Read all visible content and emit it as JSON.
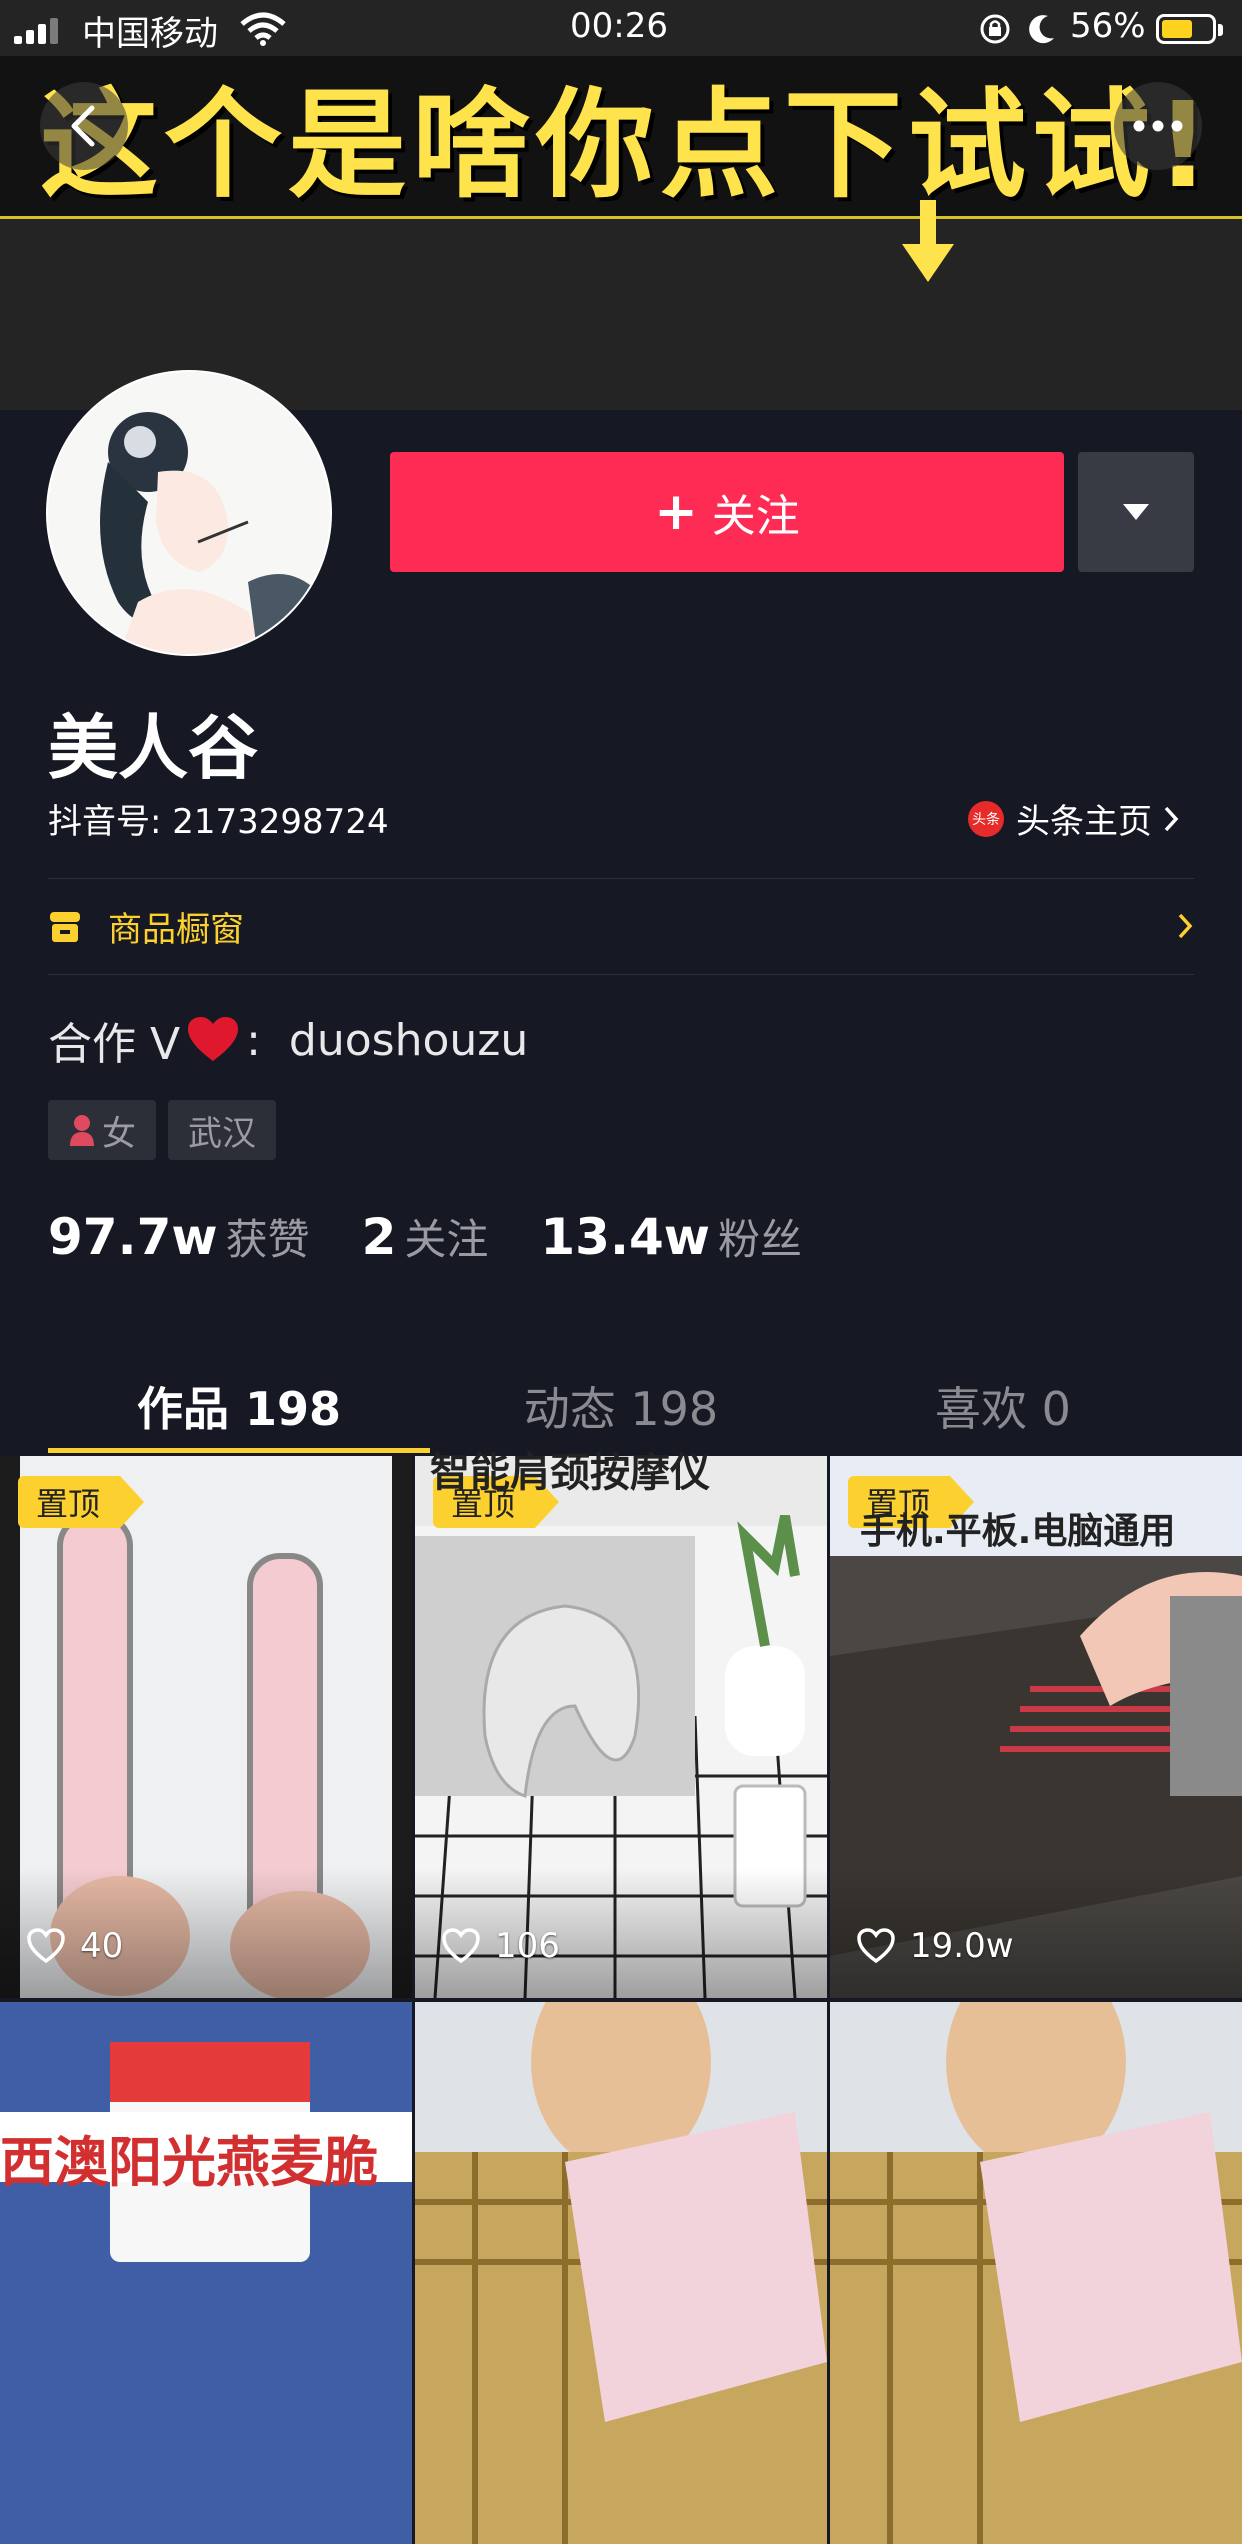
{
  "status_bar": {
    "carrier": "中国移动",
    "time": "00:26",
    "battery": "56%"
  },
  "banner": {
    "text": "这个是啥你点下试试!"
  },
  "profile": {
    "follow_label": "关注",
    "name": "美人谷",
    "douyin_id": "抖音号: 2173298724",
    "toutiao_icon_text": "头条",
    "toutiao_label": "头条主页",
    "shop_label": "商品橱窗",
    "bio_prefix": "合作 V",
    "bio_handle": "duoshouzu",
    "tags": {
      "gender": "女",
      "city": "武汉"
    },
    "stats": {
      "likes_num": "97.7w",
      "likes_label": "获赞",
      "following_num": "2",
      "following_label": "关注",
      "fans_num": "13.4w",
      "fans_label": "粉丝"
    }
  },
  "tabs": [
    {
      "label": "作品 198"
    },
    {
      "label": "动态 198"
    },
    {
      "label": "喜欢 0"
    }
  ],
  "videos": [
    {
      "pinned": "置顶",
      "likes": "40",
      "caption": ""
    },
    {
      "pinned": "置顶",
      "likes": "106",
      "caption": "智能肩颈按摩仪"
    },
    {
      "pinned": "置顶",
      "likes": "19.0w",
      "caption": "手机.平板.电脑通用"
    },
    {
      "pinned": "",
      "likes": "",
      "caption": "西澳阳光燕麦脆"
    },
    {
      "pinned": "",
      "likes": "",
      "caption": ""
    },
    {
      "pinned": "",
      "likes": "",
      "caption": ""
    }
  ],
  "colors": {
    "background": "#161823",
    "follow_button": "#fe2c55",
    "accent_yellow": "#fcd12f"
  }
}
